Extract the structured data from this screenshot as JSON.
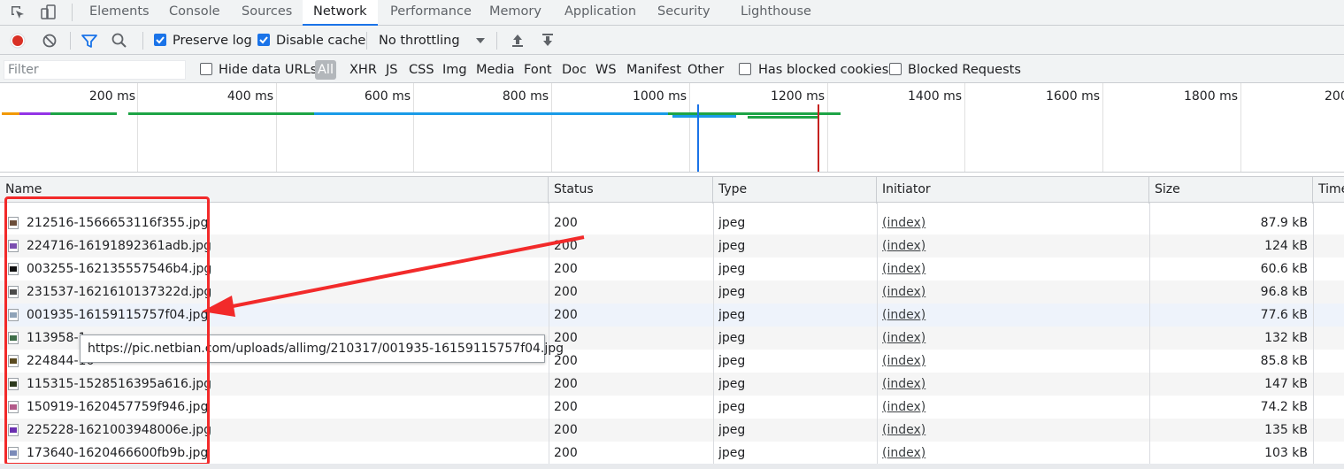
{
  "devtools": {
    "tabs": [
      "Elements",
      "Console",
      "Sources",
      "Network",
      "Performance",
      "Memory",
      "Application",
      "Security",
      "Lighthouse"
    ],
    "active_tab": "Network",
    "icons": {
      "inspect": "inspect-element-icon",
      "device": "device-toolbar-icon"
    }
  },
  "toolbar": {
    "preserve_log": {
      "label": "Preserve log",
      "checked": true
    },
    "disable_cache": {
      "label": "Disable cache",
      "checked": true
    },
    "throttling": "No throttling",
    "icons": [
      "record-icon",
      "clear-icon",
      "filter-icon",
      "search-icon",
      "import-har-icon",
      "export-har-icon"
    ],
    "colors": {
      "record": "#d93025",
      "accent": "#1a73e8"
    }
  },
  "filterbar": {
    "filter_placeholder": "Filter",
    "hide_data_urls": "Hide data URLs",
    "types": [
      "All",
      "XHR",
      "JS",
      "CSS",
      "Img",
      "Media",
      "Font",
      "Doc",
      "WS",
      "Manifest",
      "Other"
    ],
    "active_type": "All",
    "has_blocked_cookies": "Has blocked cookies",
    "blocked_requests": "Blocked Requests"
  },
  "timeline": {
    "ticks": [
      "200 ms",
      "400 ms",
      "600 ms",
      "800 ms",
      "1000 ms",
      "1200 ms",
      "1400 ms",
      "1600 ms",
      "1800 ms",
      "200"
    ]
  },
  "table": {
    "columns": [
      "Name",
      "Status",
      "Type",
      "Initiator",
      "Size",
      "Time"
    ],
    "rows": [
      {
        "name": "212516-1566653116f355.jpg",
        "status": "200",
        "type": "jpeg",
        "initiator": "(index)",
        "size": "87.9 kB",
        "thumb": "#6b4e3a"
      },
      {
        "name": "224716-16191892361adb.jpg",
        "status": "200",
        "type": "jpeg",
        "initiator": "(index)",
        "size": "124 kB",
        "thumb": "#7b4fb0"
      },
      {
        "name": "003255-162135557546b4.jpg",
        "status": "200",
        "type": "jpeg",
        "initiator": "(index)",
        "size": "60.6 kB",
        "thumb": "#111111"
      },
      {
        "name": "231537-1621610137322d.jpg",
        "status": "200",
        "type": "jpeg",
        "initiator": "(index)",
        "size": "96.8 kB",
        "thumb": "#4a4a4a"
      },
      {
        "name": "001935-16159115757f04.jpg",
        "status": "200",
        "type": "jpeg",
        "initiator": "(index)",
        "size": "77.6 kB",
        "thumb": "#8fa3b8"
      },
      {
        "name": "113958-1",
        "status": "200",
        "type": "jpeg",
        "initiator": "(index)",
        "size": "132 kB",
        "thumb": "#3f6e4a"
      },
      {
        "name": "224844-16",
        "status": "200",
        "type": "jpeg",
        "initiator": "(index)",
        "size": "85.8 kB",
        "thumb": "#5a4a20"
      },
      {
        "name": "115315-1528516395a616.jpg",
        "status": "200",
        "type": "jpeg",
        "initiator": "(index)",
        "size": "147 kB",
        "thumb": "#2d3a1e"
      },
      {
        "name": "150919-1620457759f946.jpg",
        "status": "200",
        "type": "jpeg",
        "initiator": "(index)",
        "size": "74.2 kB",
        "thumb": "#b25a8a"
      },
      {
        "name": "225228-1621003948006e.jpg",
        "status": "200",
        "type": "jpeg",
        "initiator": "(index)",
        "size": "135 kB",
        "thumb": "#6a2fb0"
      },
      {
        "name": "173640-1620466600fb9b.jpg",
        "status": "200",
        "type": "jpeg",
        "initiator": "(index)",
        "size": "103 kB",
        "thumb": "#7a8ab8"
      }
    ]
  },
  "tooltip": "https://pic.netbian.com/uploads/allimg/210317/001935-16159115757f04.jpg",
  "annotation": {
    "color": "#f22a2a"
  }
}
